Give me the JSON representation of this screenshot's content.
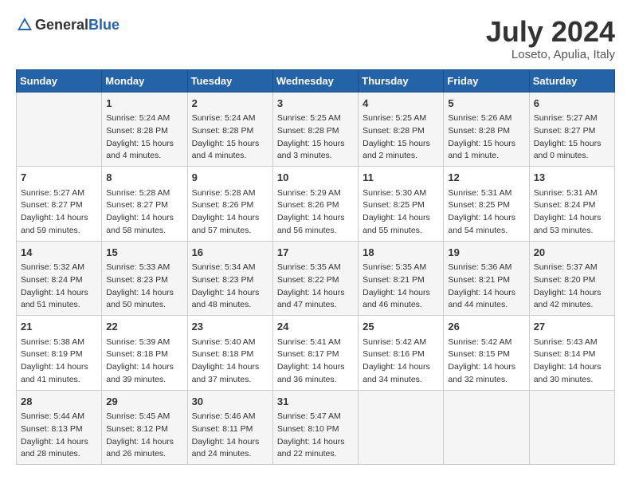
{
  "header": {
    "logo": {
      "general": "General",
      "blue": "Blue"
    },
    "title": "July 2024",
    "subtitle": "Loseto, Apulia, Italy"
  },
  "days_of_week": [
    "Sunday",
    "Monday",
    "Tuesday",
    "Wednesday",
    "Thursday",
    "Friday",
    "Saturday"
  ],
  "weeks": [
    [
      {
        "day": "",
        "info": ""
      },
      {
        "day": "1",
        "info": "Sunrise: 5:24 AM\nSunset: 8:28 PM\nDaylight: 15 hours\nand 4 minutes."
      },
      {
        "day": "2",
        "info": "Sunrise: 5:24 AM\nSunset: 8:28 PM\nDaylight: 15 hours\nand 4 minutes."
      },
      {
        "day": "3",
        "info": "Sunrise: 5:25 AM\nSunset: 8:28 PM\nDaylight: 15 hours\nand 3 minutes."
      },
      {
        "day": "4",
        "info": "Sunrise: 5:25 AM\nSunset: 8:28 PM\nDaylight: 15 hours\nand 2 minutes."
      },
      {
        "day": "5",
        "info": "Sunrise: 5:26 AM\nSunset: 8:28 PM\nDaylight: 15 hours\nand 1 minute."
      },
      {
        "day": "6",
        "info": "Sunrise: 5:27 AM\nSunset: 8:27 PM\nDaylight: 15 hours\nand 0 minutes."
      }
    ],
    [
      {
        "day": "7",
        "info": "Sunrise: 5:27 AM\nSunset: 8:27 PM\nDaylight: 14 hours\nand 59 minutes."
      },
      {
        "day": "8",
        "info": "Sunrise: 5:28 AM\nSunset: 8:27 PM\nDaylight: 14 hours\nand 58 minutes."
      },
      {
        "day": "9",
        "info": "Sunrise: 5:28 AM\nSunset: 8:26 PM\nDaylight: 14 hours\nand 57 minutes."
      },
      {
        "day": "10",
        "info": "Sunrise: 5:29 AM\nSunset: 8:26 PM\nDaylight: 14 hours\nand 56 minutes."
      },
      {
        "day": "11",
        "info": "Sunrise: 5:30 AM\nSunset: 8:25 PM\nDaylight: 14 hours\nand 55 minutes."
      },
      {
        "day": "12",
        "info": "Sunrise: 5:31 AM\nSunset: 8:25 PM\nDaylight: 14 hours\nand 54 minutes."
      },
      {
        "day": "13",
        "info": "Sunrise: 5:31 AM\nSunset: 8:24 PM\nDaylight: 14 hours\nand 53 minutes."
      }
    ],
    [
      {
        "day": "14",
        "info": "Sunrise: 5:32 AM\nSunset: 8:24 PM\nDaylight: 14 hours\nand 51 minutes."
      },
      {
        "day": "15",
        "info": "Sunrise: 5:33 AM\nSunset: 8:23 PM\nDaylight: 14 hours\nand 50 minutes."
      },
      {
        "day": "16",
        "info": "Sunrise: 5:34 AM\nSunset: 8:23 PM\nDaylight: 14 hours\nand 48 minutes."
      },
      {
        "day": "17",
        "info": "Sunrise: 5:35 AM\nSunset: 8:22 PM\nDaylight: 14 hours\nand 47 minutes."
      },
      {
        "day": "18",
        "info": "Sunrise: 5:35 AM\nSunset: 8:21 PM\nDaylight: 14 hours\nand 46 minutes."
      },
      {
        "day": "19",
        "info": "Sunrise: 5:36 AM\nSunset: 8:21 PM\nDaylight: 14 hours\nand 44 minutes."
      },
      {
        "day": "20",
        "info": "Sunrise: 5:37 AM\nSunset: 8:20 PM\nDaylight: 14 hours\nand 42 minutes."
      }
    ],
    [
      {
        "day": "21",
        "info": "Sunrise: 5:38 AM\nSunset: 8:19 PM\nDaylight: 14 hours\nand 41 minutes."
      },
      {
        "day": "22",
        "info": "Sunrise: 5:39 AM\nSunset: 8:18 PM\nDaylight: 14 hours\nand 39 minutes."
      },
      {
        "day": "23",
        "info": "Sunrise: 5:40 AM\nSunset: 8:18 PM\nDaylight: 14 hours\nand 37 minutes."
      },
      {
        "day": "24",
        "info": "Sunrise: 5:41 AM\nSunset: 8:17 PM\nDaylight: 14 hours\nand 36 minutes."
      },
      {
        "day": "25",
        "info": "Sunrise: 5:42 AM\nSunset: 8:16 PM\nDaylight: 14 hours\nand 34 minutes."
      },
      {
        "day": "26",
        "info": "Sunrise: 5:42 AM\nSunset: 8:15 PM\nDaylight: 14 hours\nand 32 minutes."
      },
      {
        "day": "27",
        "info": "Sunrise: 5:43 AM\nSunset: 8:14 PM\nDaylight: 14 hours\nand 30 minutes."
      }
    ],
    [
      {
        "day": "28",
        "info": "Sunrise: 5:44 AM\nSunset: 8:13 PM\nDaylight: 14 hours\nand 28 minutes."
      },
      {
        "day": "29",
        "info": "Sunrise: 5:45 AM\nSunset: 8:12 PM\nDaylight: 14 hours\nand 26 minutes."
      },
      {
        "day": "30",
        "info": "Sunrise: 5:46 AM\nSunset: 8:11 PM\nDaylight: 14 hours\nand 24 minutes."
      },
      {
        "day": "31",
        "info": "Sunrise: 5:47 AM\nSunset: 8:10 PM\nDaylight: 14 hours\nand 22 minutes."
      },
      {
        "day": "",
        "info": ""
      },
      {
        "day": "",
        "info": ""
      },
      {
        "day": "",
        "info": ""
      }
    ]
  ]
}
